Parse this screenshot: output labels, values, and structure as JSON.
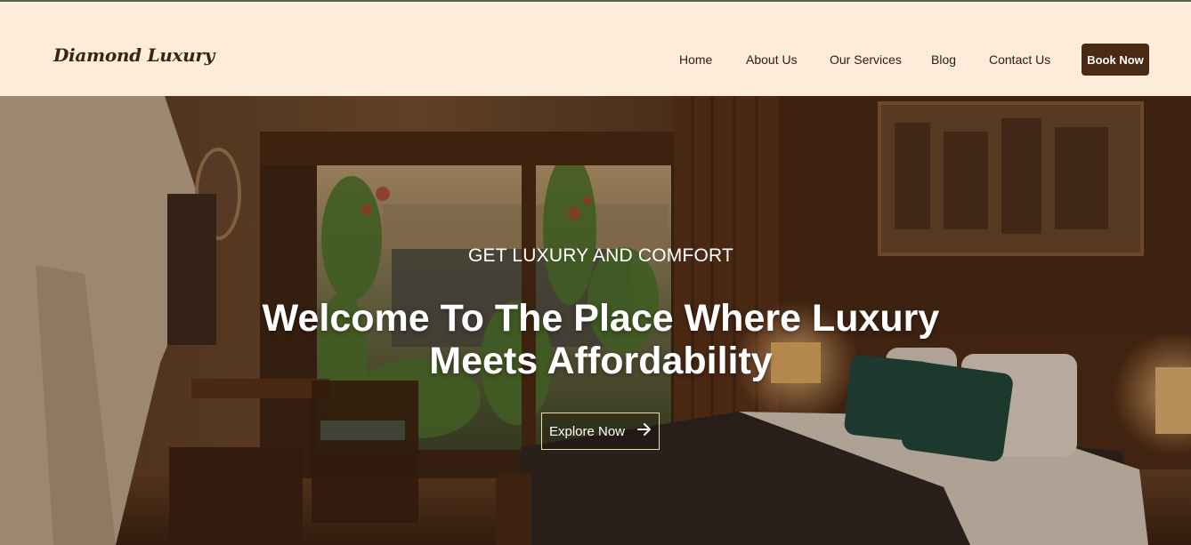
{
  "brand": {
    "logo_text": "Diamond Luxury"
  },
  "nav": {
    "items": [
      {
        "label": "Home"
      },
      {
        "label": "About Us"
      },
      {
        "label": "Our Services"
      },
      {
        "label": "Blog"
      },
      {
        "label": "Contact Us"
      }
    ],
    "cta_label": "Book Now"
  },
  "hero": {
    "eyebrow": "GET LUXURY AND COMFORT",
    "headline_line1": "Welcome To The Place Where Luxury",
    "headline_line2": "Meets Affordability",
    "button_label": "Explore Now",
    "button_icon": "arrow-right-icon",
    "image_subject": "hotel-bedroom"
  },
  "colors": {
    "nav_background": "#fdecd9",
    "brand_dark": "#4a2a12",
    "hero_text": "#ffffff",
    "button_border": "#f3d9a8"
  }
}
